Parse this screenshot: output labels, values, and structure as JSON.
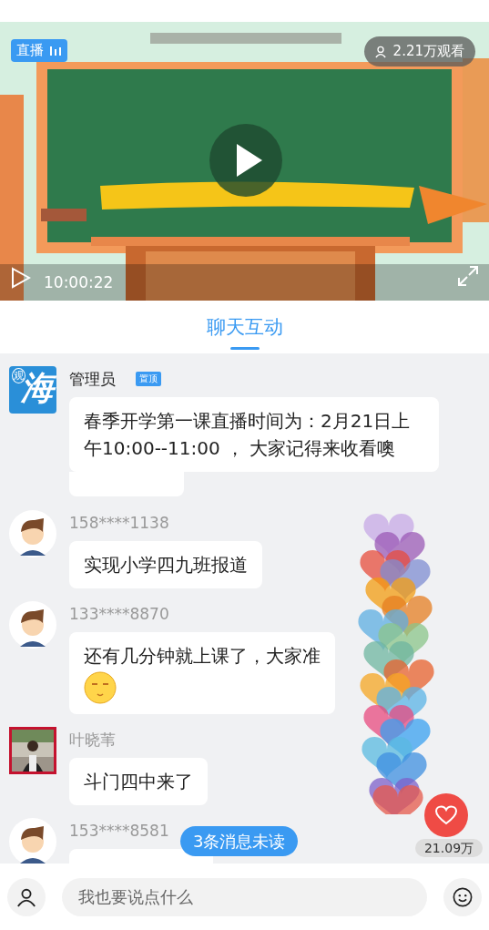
{
  "video": {
    "live_badge": "直播",
    "viewers": "2.21万观看",
    "elapsed": "10:00:22"
  },
  "tabs": [
    {
      "label": "聊天互动",
      "selected": true
    }
  ],
  "messages": [
    {
      "kind": "admin",
      "avatar_mark": "观",
      "avatar_text": "海",
      "name": "管理员",
      "badge": "置顶",
      "text": "春季开学第一课直播时间为：2月21日上午10:00--11:00 ， 大家记得来收看噢"
    },
    {
      "kind": "cartoon",
      "name": "158****1138",
      "text": "实现小学四九班报道"
    },
    {
      "kind": "cartoon",
      "name": "133****8870",
      "text": "还有几分钟就上课了，大家准",
      "emoji": true
    },
    {
      "name": "叶晓苇",
      "text": "斗门四中来了"
    },
    {
      "kind": "cartoon",
      "name": "153****8581"
    }
  ],
  "unread": "3条消息未读",
  "likes": "21.09万",
  "composer": {
    "placeholder": "我也要说点什么"
  }
}
